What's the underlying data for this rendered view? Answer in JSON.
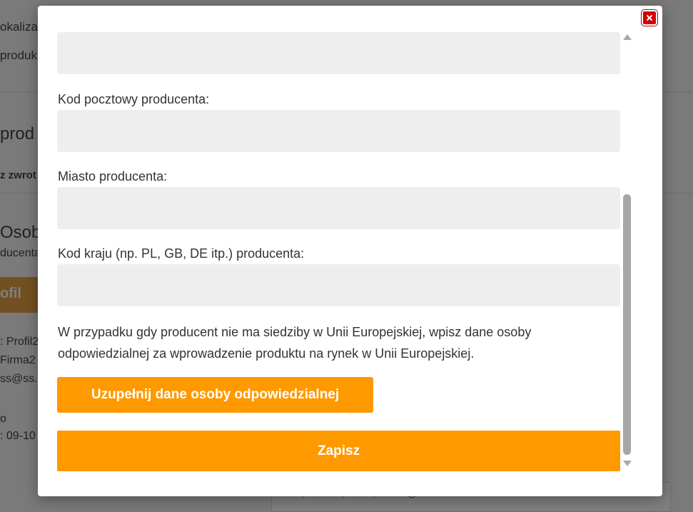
{
  "background": {
    "line1": "okalizac",
    "line2": "produk",
    "line3": "prod",
    "line4": "z zwrot",
    "line5": "Osob",
    "line6": "ducenta",
    "orange_label": "ofil",
    "line7": ": Profil2",
    "line8": "Firma2",
    "line9": "ss@ss.",
    "line10": "o",
    "line11": ": 09-10",
    "card_text": "092, Miasto, Ulica, email@ss.com"
  },
  "modal": {
    "fields": [
      {
        "label": "",
        "value": ""
      },
      {
        "label": "Kod pocztowy producenta:",
        "value": ""
      },
      {
        "label": "Miasto producenta:",
        "value": ""
      },
      {
        "label": "Kod kraju (np. PL, GB, DE itp.) producenta:",
        "value": ""
      }
    ],
    "note": "W przypadku gdy producent nie ma siedziby w Unii Europejskiej, wpisz dane osoby odpowiedzialnej za wprowadzenie produktu na rynek w Unii Europejskiej.",
    "responsible_button": "Uzupełnij dane osoby odpowiedzialnej",
    "save_button": "Zapisz"
  },
  "colors": {
    "accent": "#ff9900",
    "close": "#d40000",
    "input_bg": "#eeeeee"
  }
}
